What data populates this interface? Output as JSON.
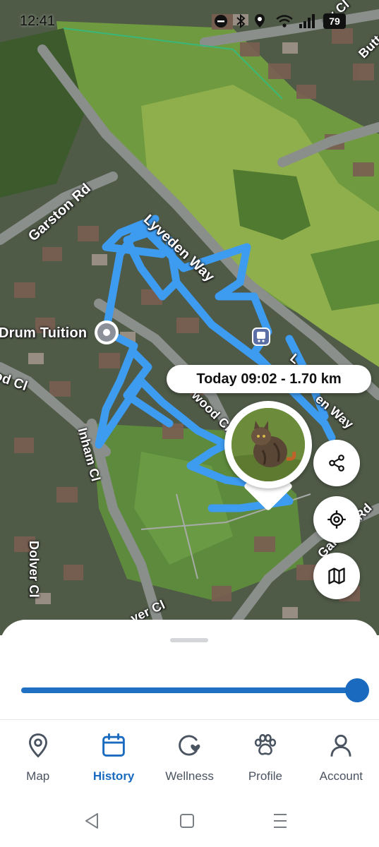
{
  "status_bar": {
    "time": "12:41",
    "battery": "79"
  },
  "map": {
    "labels": {
      "garston_rd_top": "Garston Rd",
      "lyveden_way": "Lyveden Way",
      "drum_tuition": "Drum Tuition",
      "od_cl": "od Cl",
      "inham_cl": "Inham Cl",
      "wood_cl": "wood Cl",
      "lyveden_way_2": "L",
      "lyveden_way_3": "en Way",
      "garston_rd_right": "Garston Rd",
      "dolver_cl": "Dolver Cl",
      "dolver_cl_2": "ver Cl",
      "top_right_1": "Butt",
      "top_right_2": "sy Cl"
    },
    "trip_badge": "Today 09:02 - 1.70 km",
    "route_color": "#3d9bf0",
    "accent": "#1a6bbf"
  },
  "fabs": {
    "share": "share-icon",
    "locate": "crosshair-icon",
    "map_type": "map-icon"
  },
  "timeline": {
    "slider_position": 1.0
  },
  "tabs": [
    {
      "label": "Map",
      "icon": "map-pin-icon",
      "active": false
    },
    {
      "label": "History",
      "icon": "calendar-icon",
      "active": true
    },
    {
      "label": "Wellness",
      "icon": "wellness-icon",
      "active": false
    },
    {
      "label": "Profile",
      "icon": "paw-icon",
      "active": false
    },
    {
      "label": "Account",
      "icon": "person-icon",
      "active": false
    }
  ]
}
